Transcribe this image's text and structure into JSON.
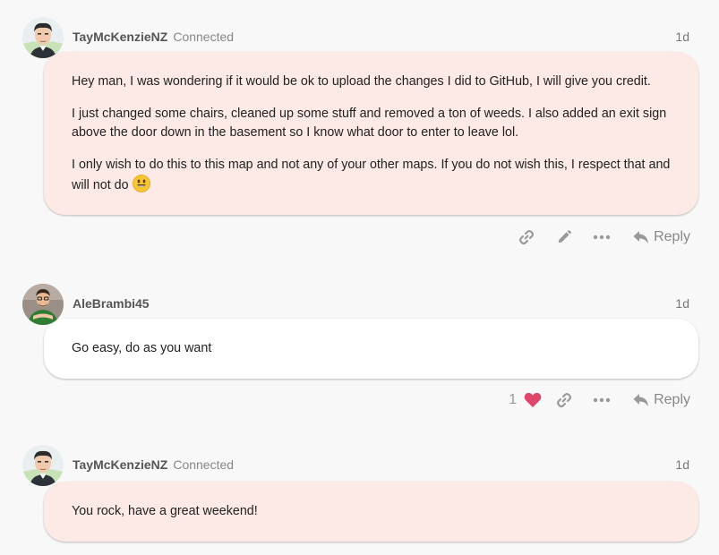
{
  "posts": [
    {
      "username": "TayMcKenzieNZ",
      "status": "Connected",
      "time": "1d",
      "paragraphs": [
        "Hey man, I was wondering if it would be ok to upload the changes I did to GitHub, I will give you credit.",
        "I just changed some chairs, cleaned up some stuff and removed a ton of weeds. I also added an exit sign above the door down in the basement so I know what door to enter to leave lol.",
        "I only wish to do this to this map and not any of your other maps. If you do not wish this, I respect that and will not do"
      ],
      "reply_label": "Reply"
    },
    {
      "username": "AleBrambi45",
      "time": "1d",
      "paragraphs": [
        "Go easy, do as you want"
      ],
      "like_count": "1",
      "reply_label": "Reply"
    },
    {
      "username": "TayMcKenzieNZ",
      "status": "Connected",
      "time": "1d",
      "paragraphs": [
        "You rock, have a great weekend!"
      ]
    }
  ],
  "colors": {
    "own_bubble": "#fde9e5",
    "other_bubble": "#ffffff",
    "heart": "#e0456b"
  }
}
